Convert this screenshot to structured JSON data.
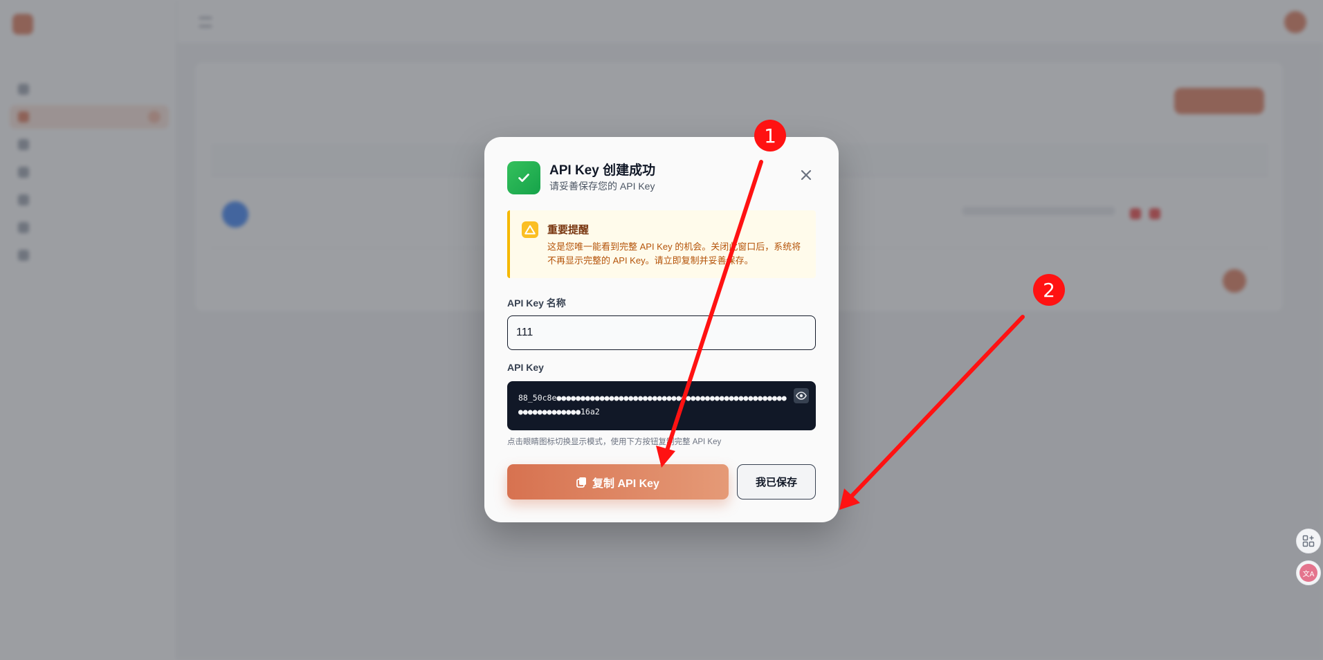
{
  "modal": {
    "title": "API Key 创建成功",
    "subtitle": "请妥善保存您的 API Key",
    "warning": {
      "title": "重要提醒",
      "text": "这是您唯一能看到完整 API Key 的机会。关闭此窗口后，系统将不再显示完整的 API Key。请立即复制并妥善保存。"
    },
    "name_label": "API Key 名称",
    "name_value": "111",
    "key_label": "API Key",
    "key_masked": "88_50c8e●●●●●●●●●●●●●●●●●●●●●●●●●●●●●●●●●●●●●●●●●●●●●●●●●●●●●●●●●●●●●16a2",
    "hint": "点击眼睛图标切换显示模式，使用下方按钮复制完整 API Key",
    "copy_label": "复制 API Key",
    "saved_label": "我已保存"
  },
  "annotations": {
    "badge_1": "1",
    "badge_2": "2",
    "color": "#ff1212"
  },
  "icons": {
    "success": "check-icon",
    "close": "close-icon",
    "warning": "warning-triangle-icon",
    "eye": "eye-icon",
    "copy": "copy-icon",
    "apps": "apps-grid-icon",
    "translate": "translate-icon"
  },
  "colors": {
    "accent": "#d77250",
    "success": "#22c55e",
    "warning_border": "#f5b800",
    "key_box": "#111827"
  }
}
